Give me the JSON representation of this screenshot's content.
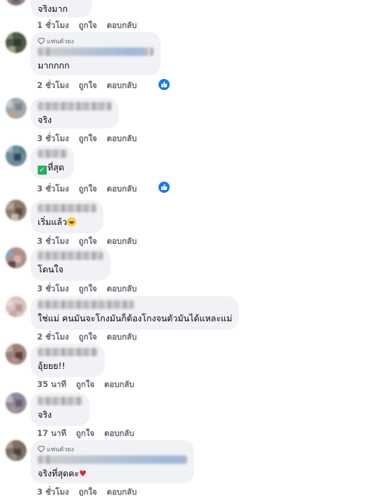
{
  "actions": {
    "like_label": "ถูกใจ",
    "reply_label": "ตอบกลับ"
  },
  "fan_badge_label": "แฟนตัวยง",
  "colors": {
    "bubble": "#f0f2f5",
    "meta": "#65676b",
    "like_blue": "#1877f2"
  },
  "comments": [
    {
      "text": "จริงมาก",
      "time": "1 ชั่วโมง",
      "liked": false
    },
    {
      "text": "มากกกก",
      "time": "2 ชั่วโมง",
      "liked": true,
      "fan_badge": true
    },
    {
      "text": "จริง",
      "time": "3 ชั่วโมง",
      "liked": false
    },
    {
      "text": "ที่สุด",
      "time": "3 ชั่วโมง",
      "liked": true
    },
    {
      "text": "เริ่มแล้ว",
      "time": "3 ชั่วโมง",
      "liked": false
    },
    {
      "text": "โดนใจ",
      "time": "3 ชั่วโมง",
      "liked": false
    },
    {
      "text": "ใช่แม่ คนมันจะโกงมันก็ต้องโกงจนตัวมันได้แหละแม่",
      "time": "2 ชั่วโมง",
      "liked": false
    },
    {
      "text": "อุ้ยยย!!",
      "time": "35 นาที",
      "liked": false
    },
    {
      "text": "จริง",
      "time": "17 นาที",
      "liked": false
    },
    {
      "text": "จริงที่สุดคะ",
      "time": "3 ชั่วโมง",
      "liked": false,
      "fan_badge": true
    }
  ]
}
